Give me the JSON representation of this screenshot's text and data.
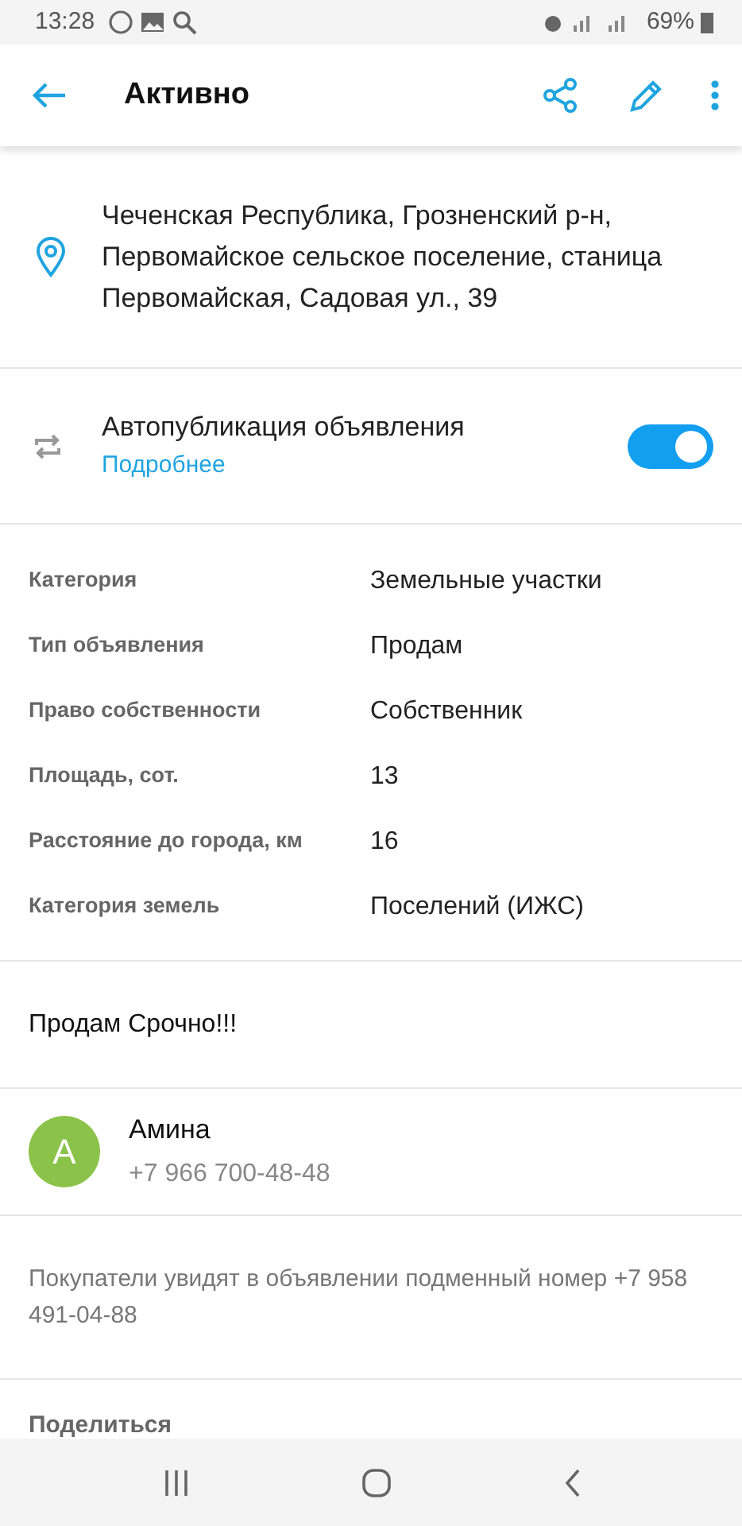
{
  "status_bar": {
    "time": "13:28",
    "battery": "69%"
  },
  "app_bar": {
    "title": "Активно"
  },
  "address": "Чеченская Республика, Грозненский р-н, Первомайское сельское поселение, станица Первомайская, Садовая ул., 39",
  "autopublish": {
    "label": "Автопубликация объявления",
    "link": "Подробнее",
    "on": true
  },
  "details": [
    {
      "label": "Категория",
      "value": "Земельные участки"
    },
    {
      "label": "Тип объявления",
      "value": "Продам"
    },
    {
      "label": "Право собственности",
      "value": "Собственник"
    },
    {
      "label": "Площадь, сот.",
      "value": "13"
    },
    {
      "label": "Расстояние до города, км",
      "value": "16"
    },
    {
      "label": "Категория земель",
      "value": "Поселений (ИЖС)"
    }
  ],
  "description": "Продам Срочно!!!",
  "contact": {
    "initial": "А",
    "name": "Амина",
    "phone": "+7 966 700-48-48",
    "color": "#8bc34a"
  },
  "note": "Покупатели увидят в объявлении подменный номер +7 958 491-04-88",
  "share_heading": "Поделиться"
}
